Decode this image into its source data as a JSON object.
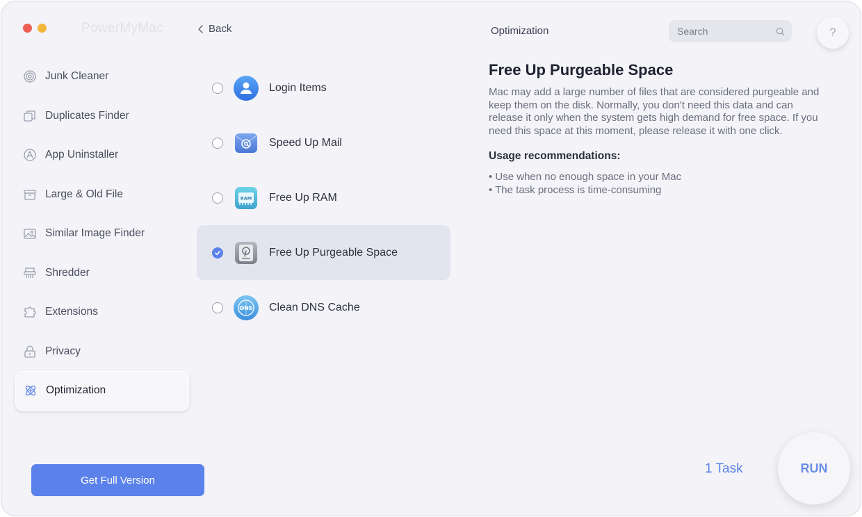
{
  "app": {
    "title": "PowerMyMac"
  },
  "header": {
    "back_label": "Back",
    "title": "Optimization",
    "search_placeholder": "Search",
    "help_label": "?"
  },
  "sidebar": {
    "items": [
      {
        "label": "Junk Cleaner",
        "icon": "junk-cleaner-icon"
      },
      {
        "label": "Duplicates Finder",
        "icon": "duplicates-icon"
      },
      {
        "label": "App Uninstaller",
        "icon": "app-uninstaller-icon"
      },
      {
        "label": "Large & Old File",
        "icon": "large-old-file-icon"
      },
      {
        "label": "Similar Image Finder",
        "icon": "image-icon"
      },
      {
        "label": "Shredder",
        "icon": "shredder-icon"
      },
      {
        "label": "Extensions",
        "icon": "extensions-icon"
      },
      {
        "label": "Privacy",
        "icon": "lock-icon"
      },
      {
        "label": "Optimization",
        "icon": "optimization-icon",
        "active": true
      }
    ],
    "full_version_label": "Get Full Version"
  },
  "tasks_list": {
    "items": [
      {
        "label": "Login Items",
        "icon": "user-icon",
        "checked": false
      },
      {
        "label": "Speed Up Mail",
        "icon": "mail-at-icon",
        "checked": false
      },
      {
        "label": "Free Up RAM",
        "icon": "ram-icon",
        "icon_text": "RAM",
        "checked": false
      },
      {
        "label": "Free Up Purgeable Space",
        "icon": "disk-icon",
        "checked": true
      },
      {
        "label": "Clean DNS Cache",
        "icon": "dns-icon",
        "icon_text": "DNS",
        "checked": false
      }
    ]
  },
  "details": {
    "title": "Free Up Purgeable Space",
    "description": "Mac may add a large number of files that are considered purgeable and keep them on the disk. Normally, you don't need this data and can release it only when the system gets high demand for free space. If you need this space at this moment, please release it with one click.",
    "usage_heading": "Usage recommendations:",
    "usage": [
      "• Use when no enough space in your Mac",
      "• The task process is time-consuming"
    ]
  },
  "footer": {
    "task_count": "1 Task",
    "run_label": "RUN"
  },
  "colors": {
    "accent": "#5b82ea",
    "window_bg": "#f3f3f8",
    "selected_row": "#e3e5ee"
  }
}
